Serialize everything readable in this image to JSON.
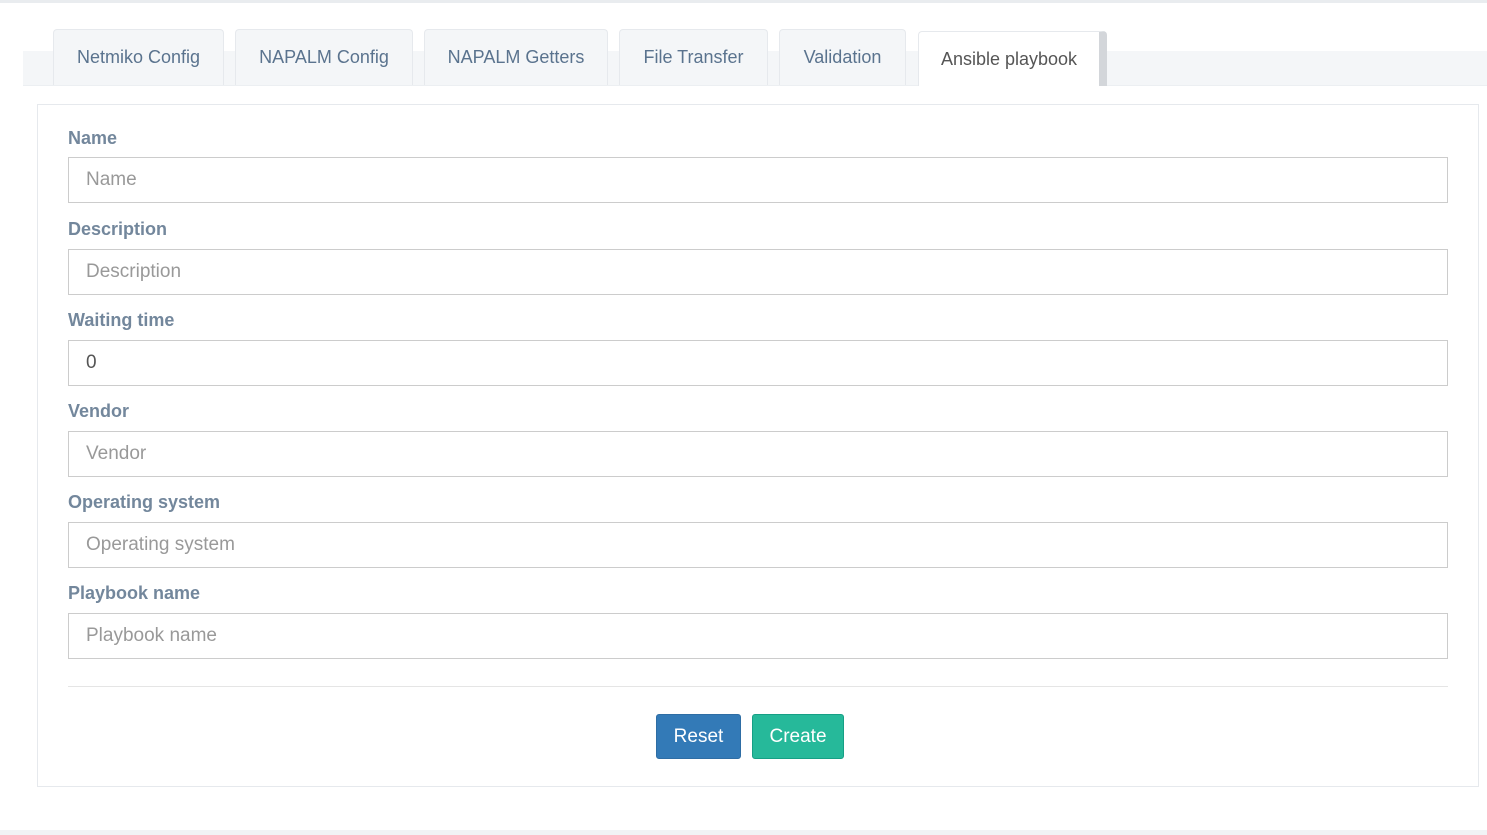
{
  "tabs": [
    {
      "label": "Netmiko Config"
    },
    {
      "label": "NAPALM Config"
    },
    {
      "label": "NAPALM Getters"
    },
    {
      "label": "File Transfer"
    },
    {
      "label": "Validation"
    },
    {
      "label": "Ansible playbook",
      "active": true
    }
  ],
  "form": {
    "name": {
      "label": "Name",
      "placeholder": "Name",
      "value": ""
    },
    "description": {
      "label": "Description",
      "placeholder": "Description",
      "value": ""
    },
    "waiting_time": {
      "label": "Waiting time",
      "value": "0"
    },
    "vendor": {
      "label": "Vendor",
      "placeholder": "Vendor",
      "value": ""
    },
    "operating_system": {
      "label": "Operating system",
      "placeholder": "Operating system",
      "value": ""
    },
    "playbook_name": {
      "label": "Playbook name",
      "placeholder": "Playbook name",
      "value": ""
    }
  },
  "buttons": {
    "reset_label": "Reset",
    "create_label": "Create"
  },
  "colors": {
    "primary": "#337ab7",
    "success": "#26b99a",
    "label": "#73879c",
    "tab_text": "#5a738e"
  }
}
